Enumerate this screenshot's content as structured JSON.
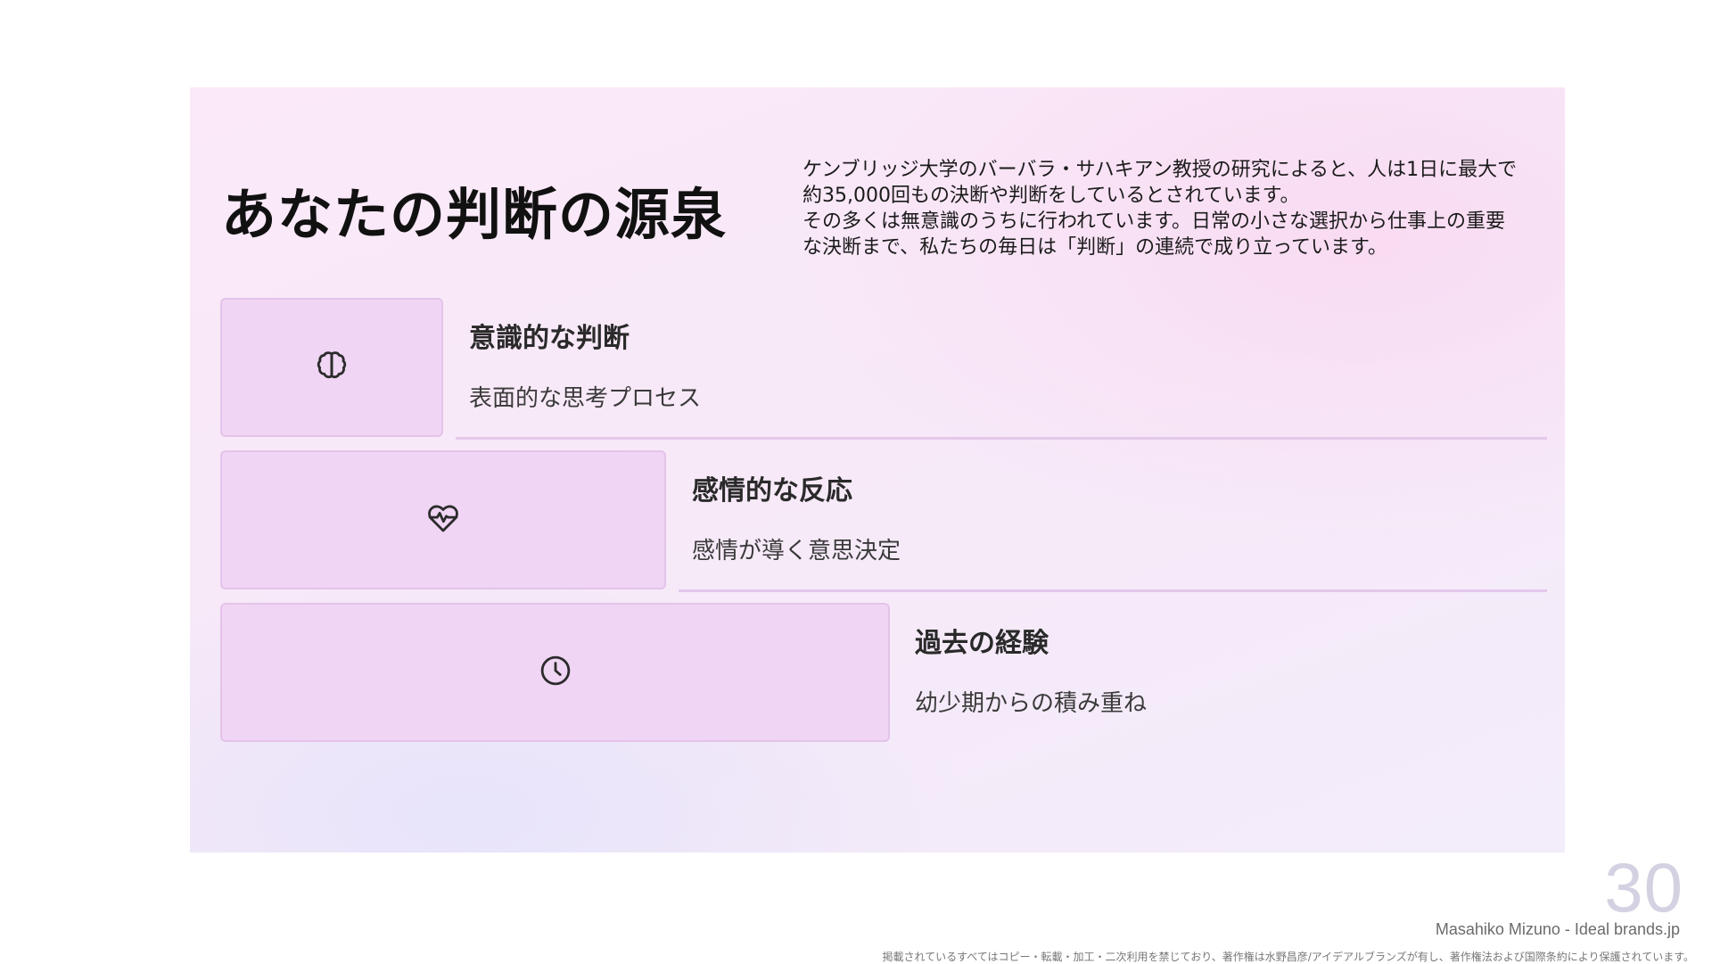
{
  "slide": {
    "title": "あなたの判断の源泉",
    "intro_lines": [
      "ケンブリッジ大学のバーバラ・サハキアン教授の研究によると、人は1日に最大で",
      "約35,000回もの決断や判断をしているとされています。",
      "その多くは無意識のうちに行われています。日常の小さな選択から仕事上の重要",
      "な決断まで、私たちの毎日は「判断」の連続で成り立っています。"
    ],
    "items": [
      {
        "icon": "brain-icon",
        "title": "意識的な判断",
        "subtitle": "表面的な思考プロセス"
      },
      {
        "icon": "heart-pulse-icon",
        "title": "感情的な反応",
        "subtitle": "感情が導く意思決定"
      },
      {
        "icon": "clock-icon",
        "title": "過去の経験",
        "subtitle": "幼少期からの積み重ね"
      }
    ]
  },
  "footer": {
    "page_number": "30",
    "author": "Masahiko Mizuno - Ideal brands.jp",
    "copyright": "掲載されているすべてはコピー・転載・加工・二次利用を禁じており、著作権は水野昌彦/アイデアルブランズが有し、著作権法および国際条約により保護されています。"
  },
  "colors": {
    "block_fill": "#f0d5f4",
    "block_border": "#e4c3ea",
    "divider": "#e4c8ea",
    "page_number": "#d4d2e2"
  }
}
